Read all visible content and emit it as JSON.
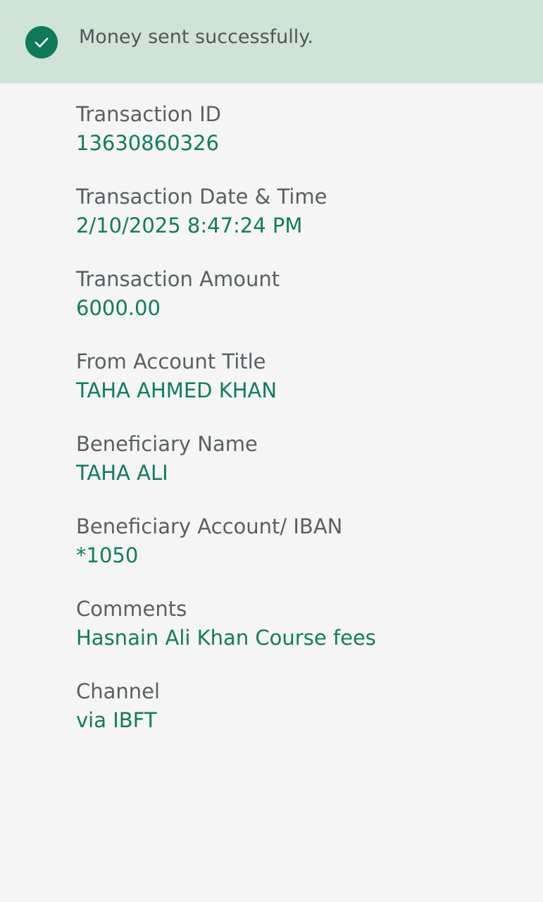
{
  "banner": {
    "icon": "check-circle-icon",
    "message": "Money sent successfully."
  },
  "details": [
    {
      "label": "Transaction ID",
      "value": "13630860326"
    },
    {
      "label": "Transaction Date & Time",
      "value": "2/10/2025 8:47:24 PM"
    },
    {
      "label": "Transaction Amount",
      "value": "6000.00"
    },
    {
      "label": "From Account Title",
      "value": "TAHA AHMED KHAN"
    },
    {
      "label": "Beneficiary Name",
      "value": "TAHA ALI"
    },
    {
      "label": "Beneficiary Account/ IBAN",
      "value": "*1050"
    },
    {
      "label": "Comments",
      "value": "Hasnain Ali Khan Course fees"
    },
    {
      "label": "Channel",
      "value": "via IBFT"
    }
  ],
  "colors": {
    "accent": "#0e7d5f",
    "banner_background": "#cfe4d6",
    "page_background": "#f5f5f5",
    "label_text": "#596064"
  }
}
